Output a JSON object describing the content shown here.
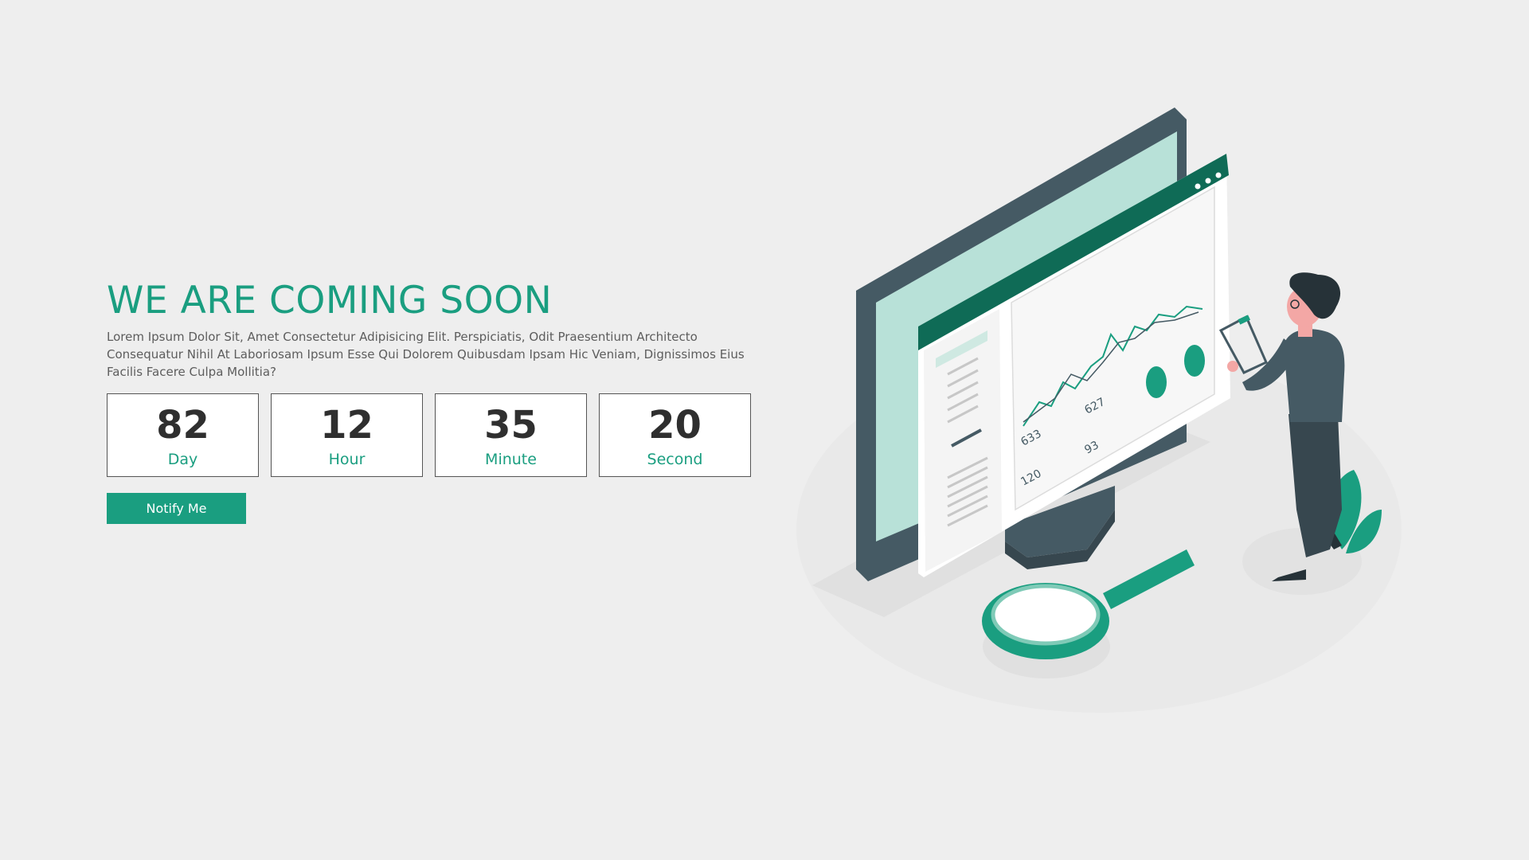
{
  "hero": {
    "title": "WE ARE COMING SOON",
    "description": "Lorem Ipsum Dolor Sit, Amet Consectetur Adipisicing Elit. Perspiciatis, Odit Praesentium Architecto Consequatur Nihil At Laboriosam Ipsum Esse Qui Dolorem Quibusdam Ipsam Hic Veniam, Dignissimos Eius Facilis Facere Culpa Mollitia?"
  },
  "countdown": [
    {
      "value": "82",
      "label": "Day"
    },
    {
      "value": "12",
      "label": "Hour"
    },
    {
      "value": "35",
      "label": "Minute"
    },
    {
      "value": "20",
      "label": "Second"
    }
  ],
  "notify_button": {
    "label": "Notify Me"
  },
  "illustration": {
    "name": "analytics-dashboard-illustration",
    "figures": [
      "633",
      "627",
      "93",
      "120"
    ]
  },
  "colors": {
    "accent": "#1a9e80",
    "background": "#eeeeee",
    "text_dark": "#2f2f2f",
    "monitor_dark": "#455a64"
  }
}
